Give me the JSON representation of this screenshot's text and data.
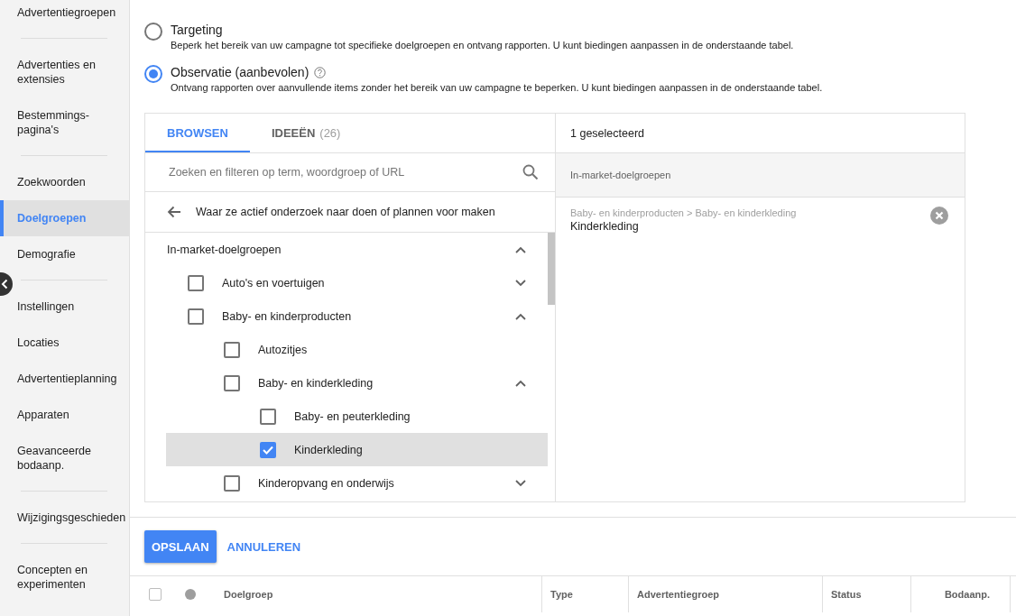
{
  "sidebar": {
    "groups": [
      [
        {
          "label": "Advertentiegroepen",
          "selected": false
        }
      ],
      [
        {
          "label": "Advertenties en extensies",
          "selected": false
        },
        {
          "label": "Bestemmings-pagina's",
          "selected": false
        }
      ],
      [
        {
          "label": "Zoekwoorden",
          "selected": false
        },
        {
          "label": "Doelgroepen",
          "selected": true
        },
        {
          "label": "Demografie",
          "selected": false
        }
      ],
      [
        {
          "label": "Instellingen",
          "selected": false
        },
        {
          "label": "Locaties",
          "selected": false
        },
        {
          "label": "Advertentieplanning",
          "selected": false
        },
        {
          "label": "Apparaten",
          "selected": false
        },
        {
          "label": "Geavanceerde bodaanp.",
          "selected": false
        }
      ],
      [
        {
          "label": "Wijzigingsgeschieden",
          "selected": false
        }
      ],
      [
        {
          "label": "Concepten en experimenten",
          "selected": false
        }
      ]
    ]
  },
  "options": [
    {
      "title": "Targeting",
      "description": "Beperk het bereik van uw campagne tot specifieke doelgroepen en ontvang rapporten. U kunt biedingen aanpassen in de onderstaande tabel.",
      "selected": false,
      "help": false
    },
    {
      "title": "Observatie (aanbevolen)",
      "description": "Ontvang rapporten over aanvullende items zonder het bereik van uw campagne te beperken. U kunt biedingen aanpassen in de onderstaande tabel.",
      "selected": true,
      "help": true
    }
  ],
  "browser": {
    "tabs": [
      {
        "label": "BROWSEN",
        "selected": true
      },
      {
        "label": "IDEEËN",
        "count": "(26)",
        "selected": false
      }
    ],
    "search": {
      "placeholder": "Zoeken en filteren op term, woordgroep of URL"
    },
    "breadcrumb": "Waar ze actief onderzoek naar doen of plannen voor maken",
    "tree": [
      {
        "kind": "heading",
        "label": "In-market-doelgroepen",
        "expanded": true,
        "children": [
          {
            "kind": "option",
            "label": "Auto's en voertuigen",
            "checked": false,
            "selected": false,
            "expanded": false
          },
          {
            "kind": "option",
            "label": "Baby- en kinderproducten",
            "checked": false,
            "selected": false,
            "expanded": true,
            "children": [
              {
                "kind": "option",
                "label": "Autozitjes",
                "checked": false,
                "selected": false
              },
              {
                "kind": "option",
                "label": "Baby- en kinderkleding",
                "checked": false,
                "selected": false,
                "expanded": true,
                "children": [
                  {
                    "kind": "option",
                    "label": "Baby- en peuterkleding",
                    "checked": false,
                    "selected": false
                  },
                  {
                    "kind": "option",
                    "label": "Kinderkleding",
                    "checked": true,
                    "selected": true
                  }
                ]
              },
              {
                "kind": "option",
                "label": "Kinderopvang en onderwijs",
                "checked": false,
                "selected": false,
                "expanded": false
              }
            ]
          }
        ]
      }
    ]
  },
  "selection": {
    "summary": "1 geselecteerd",
    "group": "In-market-doelgroepen",
    "items": [
      {
        "path": "Baby- en kinderproducten > Baby- en kinderkleding",
        "label": "Kinderkleding"
      }
    ]
  },
  "actions": [
    {
      "label": "OPSLAAN",
      "kind": "primary"
    },
    {
      "label": "ANNULEREN",
      "kind": "text"
    }
  ],
  "table": {
    "select_all": {
      "checked": false
    },
    "columns": [
      {
        "label": "Doelgroep"
      },
      {
        "label": "Type"
      },
      {
        "label": "Advertentiegroep"
      },
      {
        "label": "Status"
      },
      {
        "label": "Bodaanp."
      }
    ]
  }
}
